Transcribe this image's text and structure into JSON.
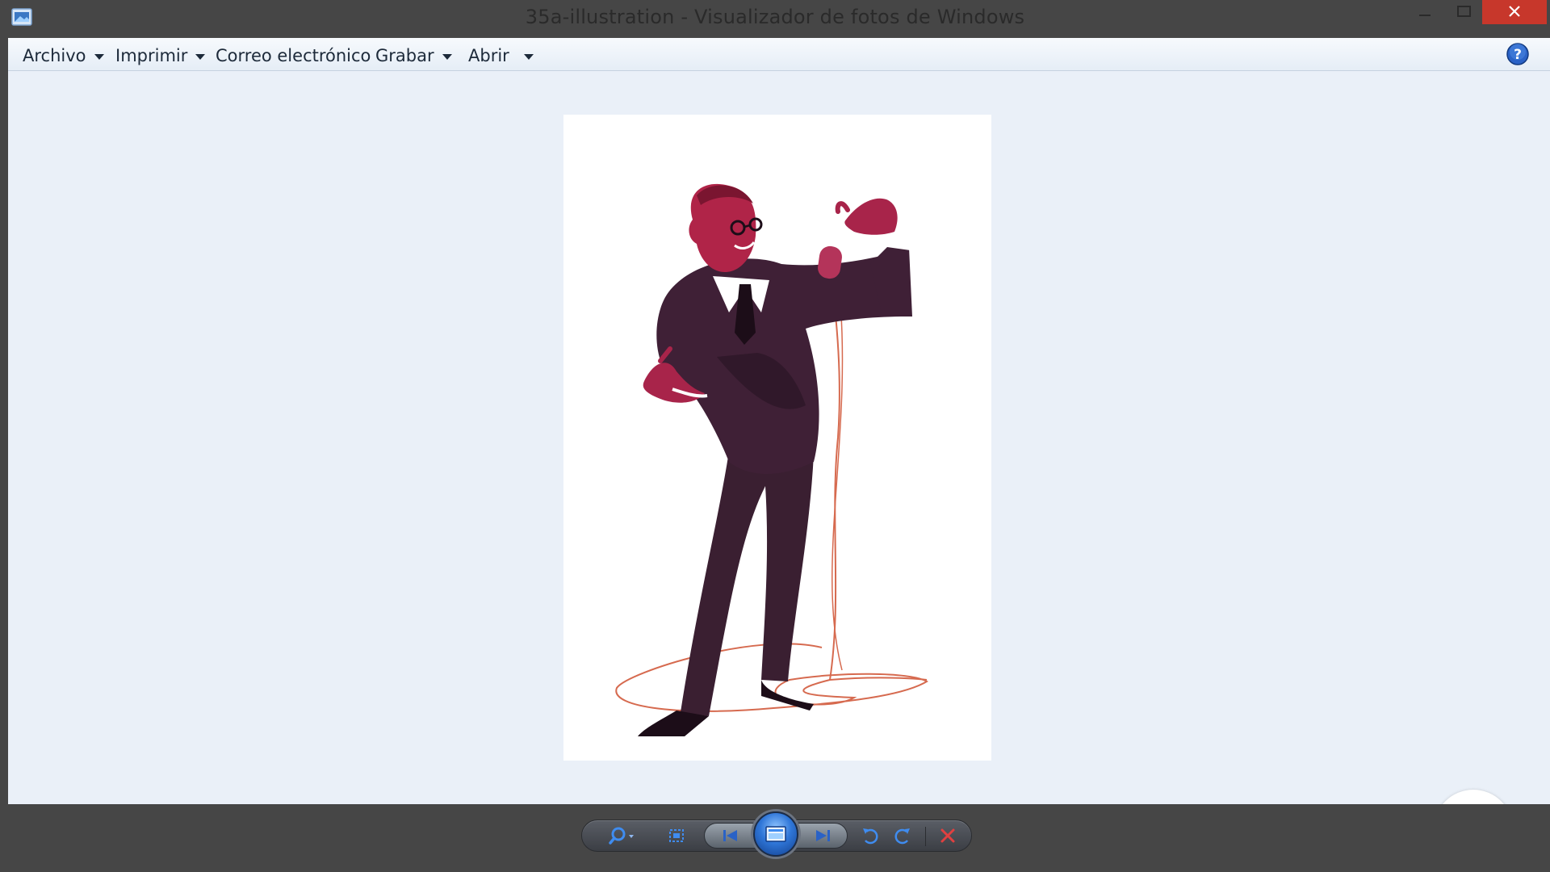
{
  "window": {
    "title": "35a-illustration - Visualizador de fotos de Windows",
    "controls": [
      "minimize-icon",
      "maximize-icon",
      "close-icon"
    ]
  },
  "menu": {
    "items": [
      {
        "label": "Archivo",
        "has_dropdown": true
      },
      {
        "label": "Imprimir",
        "has_dropdown": true
      },
      {
        "label": "Correo electrónico",
        "has_dropdown": false
      },
      {
        "label": "Grabar",
        "has_dropdown": true
      },
      {
        "label": "Abrir",
        "has_dropdown": true
      }
    ],
    "help_icon": "help-icon"
  },
  "toolbar": {
    "buttons": [
      {
        "icon": "zoom-icon"
      },
      {
        "icon": "actual-size-icon"
      },
      {
        "icon": "previous-icon"
      },
      {
        "icon": "slideshow-icon"
      },
      {
        "icon": "next-icon"
      },
      {
        "icon": "rotate-left-icon"
      },
      {
        "icon": "rotate-right-icon"
      },
      {
        "icon": "delete-icon"
      }
    ]
  },
  "colors": {
    "accent_blue": "#2f76d8",
    "close_red": "#c7372b",
    "delete_red": "#e04040",
    "logo_red": "#d0111b"
  }
}
